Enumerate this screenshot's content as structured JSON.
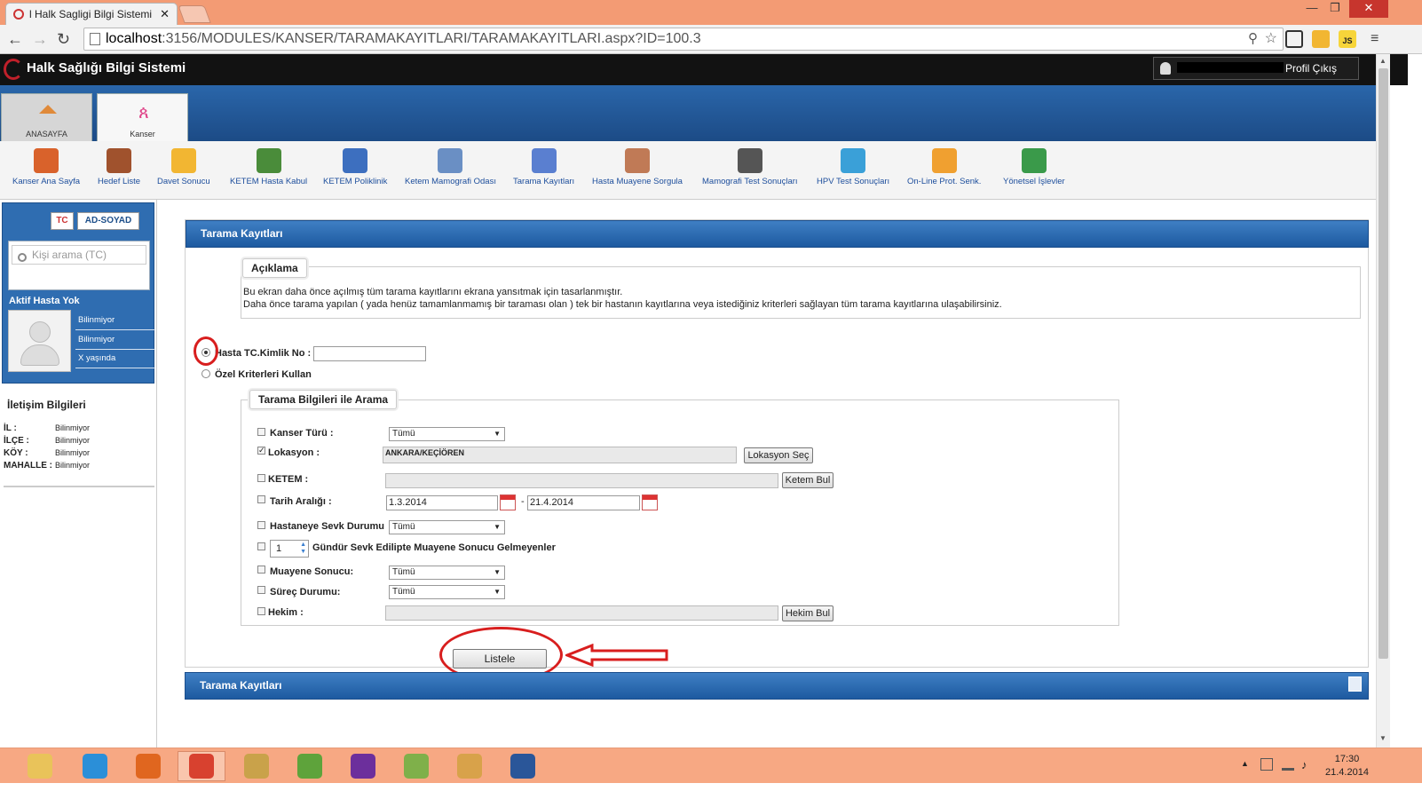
{
  "browser": {
    "tab_title": "l Halk Sagligi Bilgi Sistemi",
    "url_host": "localhost",
    "url_rest": ":3156/MODULES/KANSER/TARAMAKAYITLARI/TARAMAKAYITLARI.aspx?ID=100.3"
  },
  "app": {
    "title": "Halk Sağlığı Bilgi Sistemi",
    "user_links": "Profil Çıkış"
  },
  "modules": [
    {
      "label": "ANASAYFA"
    },
    {
      "label": "Kanser"
    }
  ],
  "toolbar": [
    {
      "label": "Kanser Ana Sayfa",
      "icon": "house-icon",
      "color": "#d9622b"
    },
    {
      "label": "Hedef Liste",
      "icon": "clipboard-icon",
      "color": "#a0522d"
    },
    {
      "label": "Davet Sonucu",
      "icon": "envelope-icon",
      "color": "#f2b632"
    },
    {
      "label": "KETEM Hasta Kabul",
      "icon": "patients-add-icon",
      "color": "#4a8c3a"
    },
    {
      "label": "KETEM Poliklinik",
      "icon": "stethoscope-icon",
      "color": "#3d6fbf"
    },
    {
      "label": "Ketem Mamografi Odası",
      "icon": "xray-board-icon",
      "color": "#6a8fc4"
    },
    {
      "label": "Tarama Kayıtları",
      "icon": "edit-list-icon",
      "color": "#5a7fd0"
    },
    {
      "label": "Hasta Muayene Sorgula",
      "icon": "doctor-search-icon",
      "color": "#c07a56"
    },
    {
      "label": "Mamografi Test Sonuçları",
      "icon": "xray-film-icon",
      "color": "#555555"
    },
    {
      "label": "HPV Test Sonuçları",
      "icon": "flask-icon",
      "color": "#3aa0d8"
    },
    {
      "label": "On-Line Prot. Senk.",
      "icon": "sync-arrows-icon",
      "color": "#f0a030"
    },
    {
      "label": "Yönetsel İşlevler",
      "icon": "pie-chart-icon",
      "color": "#3a9a4a"
    }
  ],
  "left": {
    "seg_tc": "TC",
    "seg_name": "AD-SOYAD",
    "search_placeholder": "Kişi arama (TC)",
    "active": "Aktif Hasta Yok",
    "info": [
      "Bilinmiyor",
      "Bilinmiyor",
      "X yaşında"
    ],
    "contact_title": "İletişim Bilgileri",
    "contact": [
      {
        "k": "İL :",
        "v": "Bilinmiyor"
      },
      {
        "k": "İLÇE :",
        "v": "Bilinmiyor"
      },
      {
        "k": "KÖY :",
        "v": "Bilinmiyor"
      },
      {
        "k": "MAHALLE :",
        "v": "Bilinmiyor"
      }
    ]
  },
  "main": {
    "header": "Tarama Kayıtları",
    "aciklama_title": "Açıklama",
    "desc1": "Bu ekran daha önce açılmış tüm tarama kayıtlarını ekrana yansıtmak için tasarlanmıştır.",
    "desc2": "Daha önce tarama yapılan ( yada henüz tamamlanmamış bir taraması olan ) tek bir hastanın kayıtlarına veya istediğiniz kriterleri sağlayan tüm tarama kayıtlarına ulaşabilirsiniz.",
    "radio1": "Hasta TC.Kimlik No :",
    "radio2": "Özel Kriterleri Kullan",
    "crit_title": "Tarama Bilgileri ile Arama",
    "kanser_turu": "Kanser Türü :",
    "lokasyon": "Lokasyon :",
    "lokasyon_value": "ANKARA/KEÇİÖREN",
    "lokasyon_btn": "Lokasyon Seç",
    "ketem": "KETEM :",
    "ketem_btn": "Ketem Bul",
    "tarih": "Tarih Aralığı :",
    "tarih_from": "1.3.2014",
    "tarih_sep": "-",
    "tarih_to": "21.4.2014",
    "sevk": "Hastaneye Sevk Durumu",
    "gun_value": "1",
    "gun_label": "Gündür Sevk Edilipte Muayene Sonucu Gelmeyenler",
    "muayene": "Muayene Sonucu:",
    "surec": "Süreç Durumu:",
    "hekim": "Hekim :",
    "hekim_btn": "Hekim Bul",
    "tumu": "Tümü",
    "list_btn": "Listele",
    "footer_header": "Tarama Kayıtları"
  },
  "clock": {
    "time": "17:30",
    "date": "21.4.2014"
  },
  "taskbar": [
    {
      "icon": "folder-icon",
      "color": "#e9c35a"
    },
    {
      "icon": "ie-icon",
      "color": "#2b8fd8"
    },
    {
      "icon": "firefox-icon",
      "color": "#e0661f"
    },
    {
      "icon": "chrome-icon",
      "color": "#d8412f"
    },
    {
      "icon": "tools-icon",
      "color": "#c9a24a"
    },
    {
      "icon": "frog-icon",
      "color": "#5ea33b"
    },
    {
      "icon": "visual-studio-icon",
      "color": "#6c2f9c"
    },
    {
      "icon": "chart-app-icon",
      "color": "#7fb04a"
    },
    {
      "icon": "paint-icon",
      "color": "#d8a24a"
    },
    {
      "icon": "word-icon",
      "color": "#2a5699"
    }
  ]
}
